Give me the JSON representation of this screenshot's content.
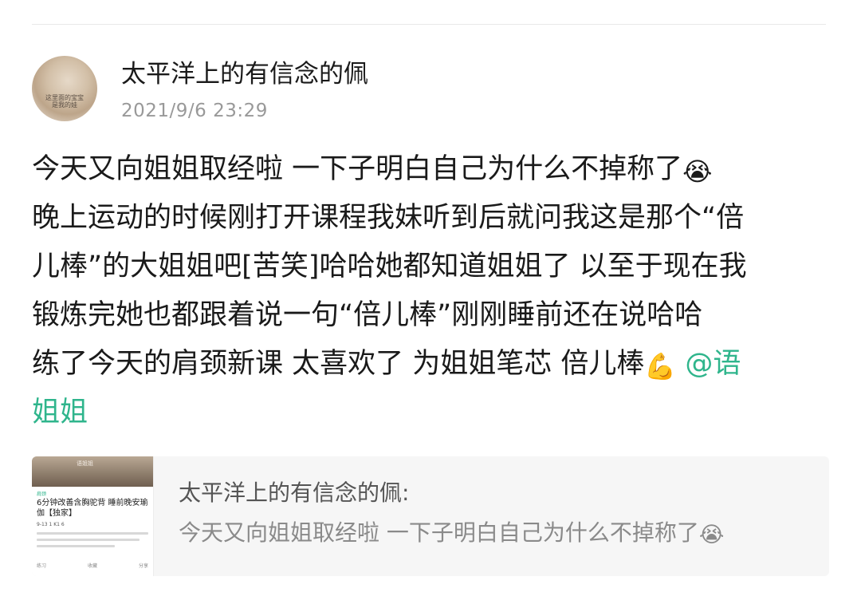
{
  "post": {
    "avatar_caption": "这里面的宝宝\n是我的娃",
    "username": "太平洋上的有信念的佩",
    "timestamp": "2021/9/6 23:29",
    "lines": [
      {
        "text": "今天又向姐姐取经啦 一下子明白自己为什么不掉称了",
        "emoji": "😭"
      },
      {
        "text": "晚上运动的时候刚打开课程我妹听到后就问我这是那个“倍"
      },
      {
        "text": "儿棒”的大姐姐吧[苦笑]哈哈她都知道姐姐了 以至于现在我"
      },
      {
        "text": "锻炼完她也都跟着说一句“倍儿棒”刚刚睡前还在说哈哈"
      },
      {
        "text": "练了今天的肩颈新课 太喜欢了 为姐姐笔芯 倍儿棒",
        "emoji": "💪",
        "mention": "@语"
      },
      {
        "mention": "姐姐"
      }
    ]
  },
  "quote": {
    "thumbnail": {
      "photo_label": "语姐姐",
      "tag": "肩颈",
      "title": "6分钟改善含胸驼背 睡前晚安瑜伽【独家】",
      "meta": "9-13 1 K1 6",
      "footer_left": "练习",
      "footer_mid": "收藏",
      "footer_right": "分享"
    },
    "author": "太平洋上的有信念的佩:",
    "text": "今天又向姐姐取经啦 一下子明白自己为什么不掉称了",
    "emoji": "😭"
  },
  "colors": {
    "mention": "#2fb58c",
    "text": "#1a1a1a",
    "muted": "#999999",
    "card_bg": "#f6f6f6"
  }
}
